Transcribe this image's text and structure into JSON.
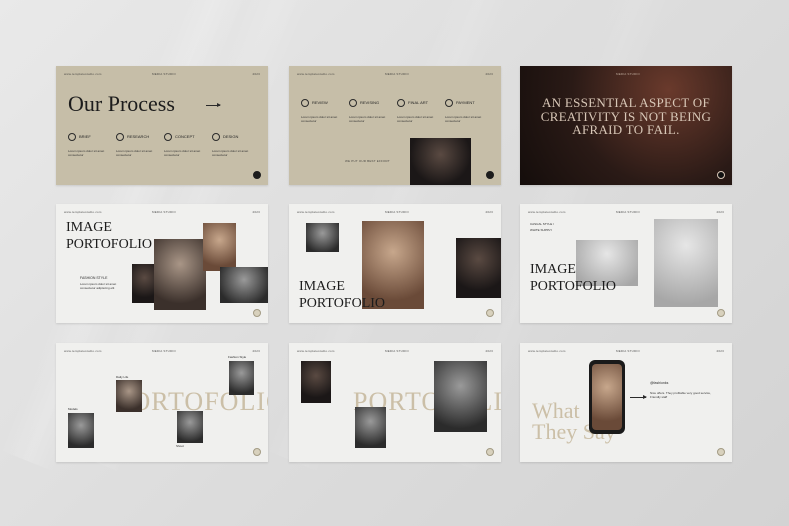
{
  "slides": {
    "our_process": {
      "url": "www.templatestudio.com",
      "studio": "MEDIA STUDIO",
      "year": "2023",
      "title": "Our Process",
      "steps": [
        {
          "label": "BRIEF",
          "text": "Lorem ipsum dolor sit amet consectetur"
        },
        {
          "label": "RESEARCH",
          "text": "Lorem ipsum dolor sit amet consectetur"
        },
        {
          "label": "CONCEPT",
          "text": "Lorem ipsum dolor sit amet consectetur"
        },
        {
          "label": "DESIGN",
          "text": "Lorem ipsum dolor sit amet consectetur"
        }
      ]
    },
    "review_steps": {
      "url": "www.templatestudio.com",
      "studio": "MEDIA STUDIO",
      "year": "2023",
      "steps": [
        {
          "label": "REVIEW",
          "text": "Lorem ipsum dolor sit amet consectetur"
        },
        {
          "label": "REVISING",
          "text": "Lorem ipsum dolor sit amet consectetur"
        },
        {
          "label": "FINAL ART",
          "text": "Lorem ipsum dolor sit amet consectetur"
        },
        {
          "label": "PAYMENT",
          "text": "Lorem ipsum dolor sit amet consectetur"
        }
      ],
      "caption": "WE PUT OUR BEST EFFORT"
    },
    "quote": {
      "studio": "MEDIA STUDIO",
      "text": "AN ESSENTIAL ASPECT OF CREATIVITY IS NOT BEING AFRAID TO FAIL."
    },
    "image_portfolio_1": {
      "url": "www.templatestudio.com",
      "studio": "MEDIA STUDIO",
      "year": "2023",
      "title_line1": "IMAGE",
      "title_line2": "PORTOFOLIO",
      "subhead": "FASHION STYLE",
      "body": "Lorem ipsum dolor sit amet consectetur adipiscing elit"
    },
    "image_portfolio_2": {
      "url": "www.templatestudio.com",
      "studio": "MEDIA STUDIO",
      "year": "2023",
      "title_line1": "IMAGE",
      "title_line2": "PORTOFOLIO"
    },
    "image_portfolio_3": {
      "url": "www.templatestudio.com",
      "studio": "MEDIA STUDIO",
      "year": "2023",
      "tag_line1": "CASUAL STYLE /",
      "tag_line2": "WHITE SUPPLY",
      "title_line1": "IMAGE",
      "title_line2": "PORTOFOLIO"
    },
    "portfolio_4": {
      "url": "www.templatestudio.com",
      "studio": "MEDIA STUDIO",
      "year": "2023",
      "word": "PORTOFOLIO",
      "labels": [
        "Fashion Style",
        "Daily Life",
        "Models",
        "Shoot"
      ]
    },
    "portfolio_5": {
      "url": "www.templatestudio.com",
      "studio": "MEDIA STUDIO",
      "year": "2023",
      "word": "PORTOFOLIO"
    },
    "testimonial": {
      "url": "www.templatestudio.com",
      "studio": "MEDIA STUDIO",
      "year": "2023",
      "title_line1": "What",
      "title_line2": "They Say",
      "handle": "@fashionks",
      "quote": "Nice offers. They profitable very good service, Friendly staff"
    }
  },
  "icons": {
    "arrow": "arrow-right-icon",
    "nav": "circle-nav-icon"
  },
  "colors": {
    "beige": "#c6bea8",
    "light": "#f0f0ee",
    "dark": "#2a1a16",
    "accent_text": "#cbbfa7"
  }
}
